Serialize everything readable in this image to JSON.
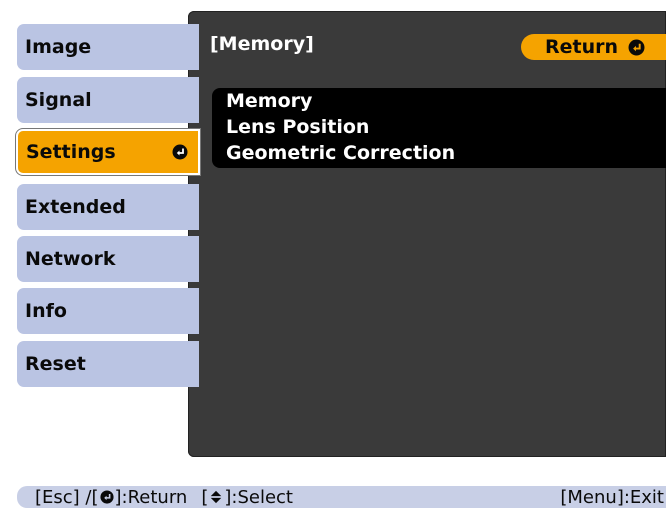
{
  "sidebar": {
    "items": [
      {
        "label": "Image"
      },
      {
        "label": "Signal"
      },
      {
        "label": "Settings"
      },
      {
        "label": "Extended"
      },
      {
        "label": "Network"
      },
      {
        "label": "Info"
      },
      {
        "label": "Reset"
      }
    ],
    "active_index": 2
  },
  "panel": {
    "title": "[Memory]",
    "return_label": "Return"
  },
  "submenu": {
    "items": [
      {
        "label": "Memory"
      },
      {
        "label": "Lens Position"
      },
      {
        "label": "Geometric Correction"
      }
    ]
  },
  "helpbar": {
    "esc_text": "[Esc] /[",
    "return_text": "]:Return",
    "select_prefix": "[",
    "select_text": "]:Select",
    "exit_text": "[Menu]:Exit"
  },
  "colors": {
    "accent": "#f5a300",
    "panel_bg": "#3a3a3a",
    "tab_bg": "#bac4e3",
    "submenu_bg": "#000000",
    "helpbar_bg": "#c8cfe6"
  },
  "icons": {
    "enter": "enter-icon",
    "updown": "up-down-arrow-icon"
  }
}
